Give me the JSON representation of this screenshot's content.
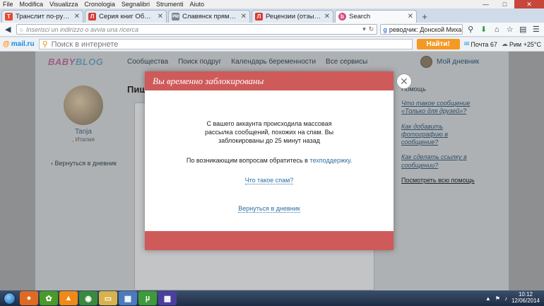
{
  "menubar": {
    "items": [
      "File",
      "Modifica",
      "Visualizza",
      "Cronologia",
      "Segnalibri",
      "Strumenti",
      "Aiuto"
    ]
  },
  "tabs": [
    {
      "title": "Транслит по-русски",
      "icon": "T",
      "icon_color": "#e8482e",
      "active": false
    },
    {
      "title": "Серия книг Образователь...",
      "icon": "Л",
      "icon_color": "#d83b34",
      "active": false
    },
    {
      "title": "Славянск прямо сейчас ...",
      "icon": "PM",
      "icon_color": "#7a8794",
      "active": false
    },
    {
      "title": "Рецензии (отзывы) покуп...",
      "icon": "Л",
      "icon_color": "#d83b34",
      "active": false
    },
    {
      "title": "Search",
      "icon": "b",
      "icon_color": "#d64b86",
      "active": true
    }
  ],
  "navbar": {
    "url_placeholder": "Inserisci un indirizzo o avvia una ricerca",
    "search_value": "реводчик: Донской Михаил"
  },
  "mailbar": {
    "logo": "mail.ru",
    "search_placeholder": "Поиск в интернете",
    "find_label": "Найти!",
    "mail_label": "Почта 67",
    "weather_label": "Рим +25°C"
  },
  "site": {
    "logo_a": "BABY",
    "logo_b": "BLOG",
    "nav": [
      "Сообщества",
      "Поиск подруг",
      "Календарь беременности",
      "Все сервисы"
    ],
    "my_diary": "Мой дневник",
    "profile_name": "Tanja",
    "profile_city": ", Италия",
    "back_to_diary": "Вернуться в дневник",
    "page_title": "Пиш",
    "help_heading": "Помощь",
    "help_questions": [
      "Что такое сообщение «Только для друзей»?",
      "Как добавить фотографию в сообщение?",
      "Как сделать ссылку в сообщении?"
    ],
    "help_all": "Посмотреть всю помощь"
  },
  "modal": {
    "title": "Вы временно заблокированы",
    "message": "С вашего аккаунта происходила массовая рассылка сообщений, похожих на спам. Вы заблокированы до 25 минут назад",
    "contact_prefix": "По возникающим вопросам обратитесь в ",
    "contact_link": "техподдержку",
    "contact_suffix": ".",
    "spam_link": "Что такое спам?",
    "back_link": "Вернуться в дневник"
  },
  "taskbar": {
    "time": "10:12",
    "date": "12/06/2014"
  }
}
